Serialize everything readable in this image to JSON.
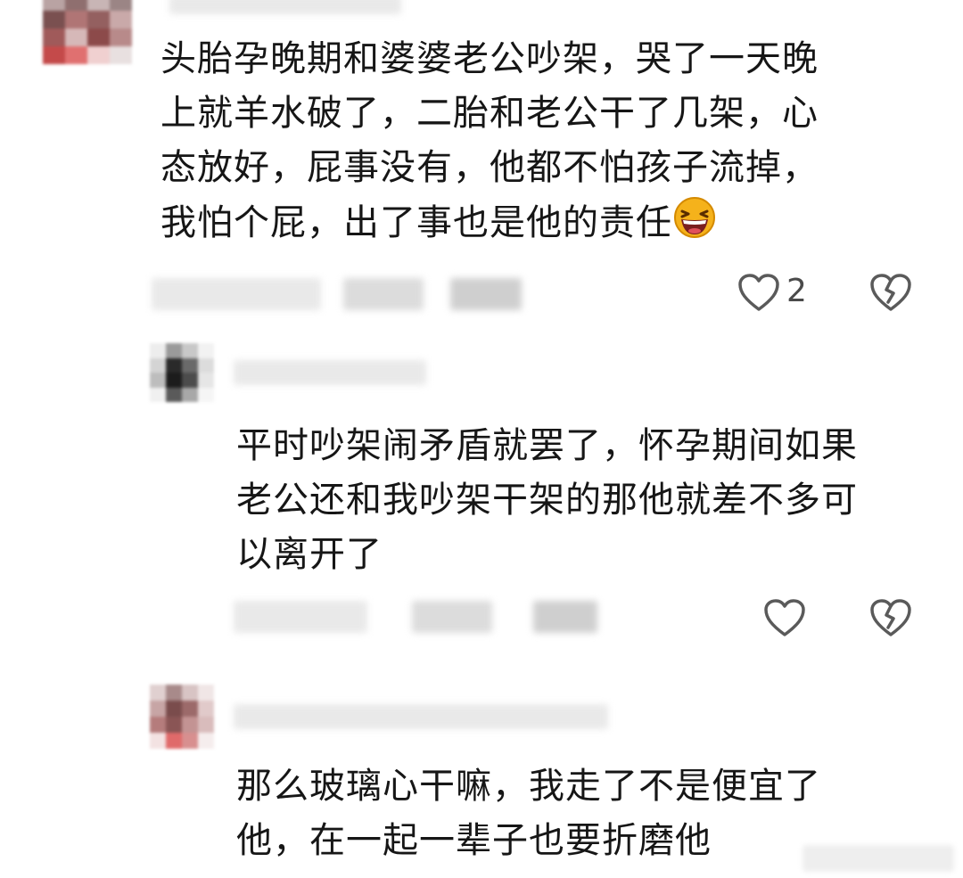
{
  "comments": [
    {
      "text": "头胎孕晚期和婆婆老公吵架，哭了一天晚\n上就羊水破了，二胎和老公干了几架，心\n态放好，屁事没有，他都不怕孩子流掉，\n我怕个屁，出了事也是他的责任",
      "emoji": "laughing-emoji",
      "like_count": "2"
    },
    {
      "text": "平时吵架闹矛盾就罢了，怀孕期间如果\n老公还和我吵架干架的那他就差不多可\n以离开了"
    },
    {
      "text": "那么玻璃心干嘛，我走了不是便宜了\n他，在一起一辈子也要折磨他"
    }
  ],
  "icons": {
    "like": "heart-outline-icon",
    "dislike": "broken-heart-icon"
  },
  "colors": {
    "icon_stroke": "#5a5a5a",
    "text": "#161616",
    "emoji_face": "#f5b21b"
  }
}
